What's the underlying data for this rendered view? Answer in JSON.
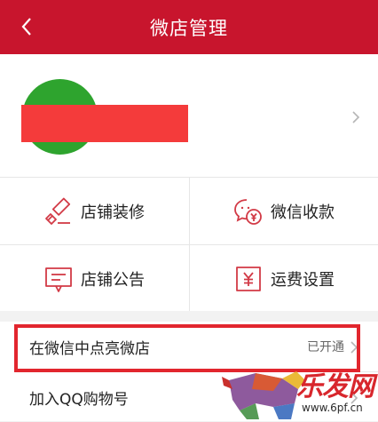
{
  "header": {
    "title": "微店管理",
    "back_icon": "chevron-left-icon",
    "background": "#c8152d"
  },
  "profile": {
    "avatar_color": "#2ea42e",
    "redaction_color": "#f43b3b"
  },
  "grid": {
    "items": [
      {
        "label": "店铺装修",
        "icon": "decorate-icon"
      },
      {
        "label": "微信收款",
        "icon": "wechat-pay-icon"
      },
      {
        "label": "店铺公告",
        "icon": "announcement-icon"
      },
      {
        "label": "运费设置",
        "icon": "shipping-fee-icon"
      }
    ],
    "icon_color": "#d23a46"
  },
  "list": {
    "items": [
      {
        "label": "在微信中点亮微店",
        "status": "已开通"
      },
      {
        "label": "加入QQ购物号",
        "status": ""
      }
    ]
  },
  "watermark": {
    "text": "乐发网",
    "url": "www.6pf.cn"
  }
}
